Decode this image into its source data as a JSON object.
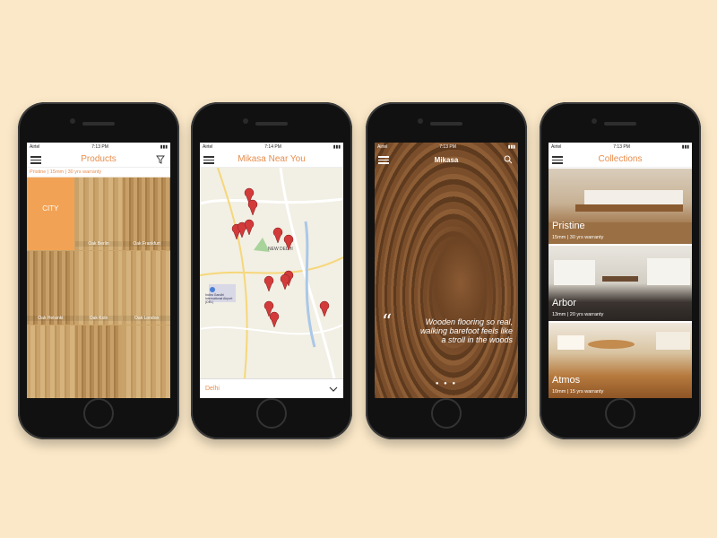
{
  "colors": {
    "accent": "#e88d4d",
    "background": "#fbe8c8"
  },
  "products_screen": {
    "status": {
      "carrier": "Airtel",
      "time": "7:13 PM"
    },
    "title": "Products",
    "subtitle": "Pristine | 15mm | 30 yrs warranty",
    "tiles": [
      "CITY",
      "Oak Berlin",
      "Oak Frankfurt",
      "Oak Helsinki",
      "Oak Koln",
      "Oak London",
      "",
      "",
      ""
    ]
  },
  "map_screen": {
    "status": {
      "carrier": "Airtel",
      "time": "7:14 PM"
    },
    "title": "Mikasa Near You",
    "city": "Delhi",
    "map_labels": {
      "new_delhi": "NEW DELHI",
      "airport": "Indira Gandhi International Airport (DEL)"
    }
  },
  "splash_screen": {
    "status": {
      "carrier": "Airtel",
      "time": "7:13 PM"
    },
    "brand": "Mikasa",
    "quote_line1": "Wooden flooring so real,",
    "quote_line2": "walking barefoot feels like",
    "quote_line3": "a stroll in the woods"
  },
  "collections_screen": {
    "status": {
      "carrier": "Airtel",
      "time": "7:13 PM"
    },
    "title": "Collections",
    "items": [
      {
        "name": "Pristine",
        "meta": "15mm | 30 yrs warranty"
      },
      {
        "name": "Arbor",
        "meta": "13mm | 20 yrs warranty"
      },
      {
        "name": "Atmos",
        "meta": "10mm | 15 yrs warranty"
      }
    ]
  }
}
